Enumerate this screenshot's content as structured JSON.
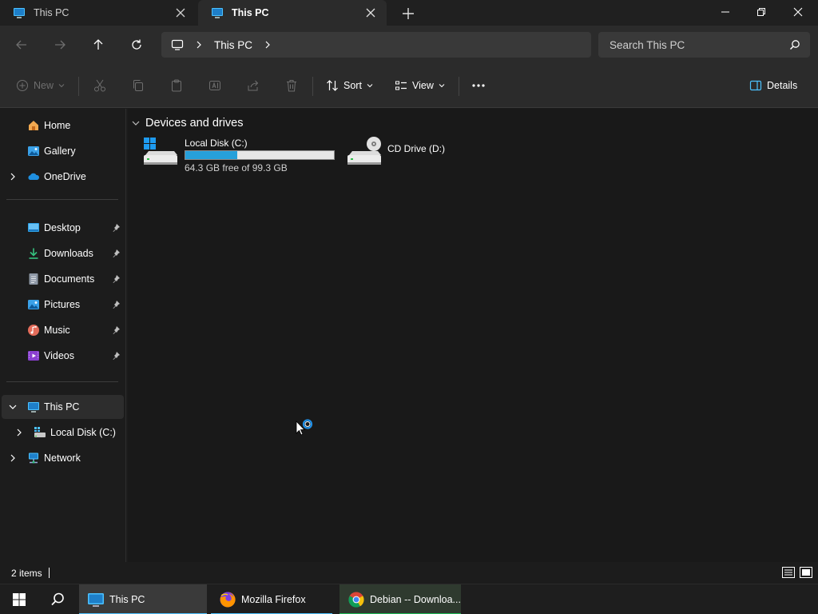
{
  "tabs": [
    {
      "label": "This PC",
      "active": false
    },
    {
      "label": "This PC",
      "active": true
    }
  ],
  "address": {
    "crumbs": [
      "This PC"
    ],
    "search_placeholder": "Search This PC"
  },
  "commandbar": {
    "new_label": "New",
    "sort_label": "Sort",
    "view_label": "View",
    "details_label": "Details"
  },
  "sidebar": {
    "top": [
      {
        "label": "Home",
        "icon": "home-icon"
      },
      {
        "label": "Gallery",
        "icon": "gallery-icon"
      },
      {
        "label": "OneDrive",
        "icon": "onedrive-icon"
      }
    ],
    "pinned": [
      {
        "label": "Desktop",
        "icon": "desktop-folder-icon"
      },
      {
        "label": "Downloads",
        "icon": "downloads-icon"
      },
      {
        "label": "Documents",
        "icon": "documents-icon"
      },
      {
        "label": "Pictures",
        "icon": "pictures-icon"
      },
      {
        "label": "Music",
        "icon": "music-icon"
      },
      {
        "label": "Videos",
        "icon": "videos-icon"
      }
    ],
    "tree": [
      {
        "label": "This PC",
        "icon": "this-pc-icon",
        "selected": true
      },
      {
        "label": "Local Disk (C:)",
        "icon": "local-disk-icon"
      },
      {
        "label": "Network",
        "icon": "network-icon"
      }
    ]
  },
  "content": {
    "group_title": "Devices and drives",
    "drives": [
      {
        "name": "Local Disk (C:)",
        "free_text": "64.3 GB free of 99.3 GB",
        "used_fraction": 0.352
      },
      {
        "name": "CD Drive (D:)"
      }
    ]
  },
  "status": {
    "item_count": "2 items"
  },
  "taskbar": {
    "apps": [
      {
        "label": "This PC",
        "icon": "file-explorer-icon",
        "accent": "#4cc2ff"
      },
      {
        "label": "Mozilla Firefox",
        "icon": "firefox-icon",
        "accent": "#4cc2ff"
      },
      {
        "label": "Debian -- Downloa...",
        "icon": "chrome-icon",
        "accent": "#1db954"
      }
    ]
  },
  "colors": {
    "accent": "#26a0da",
    "bg": "#191919"
  }
}
